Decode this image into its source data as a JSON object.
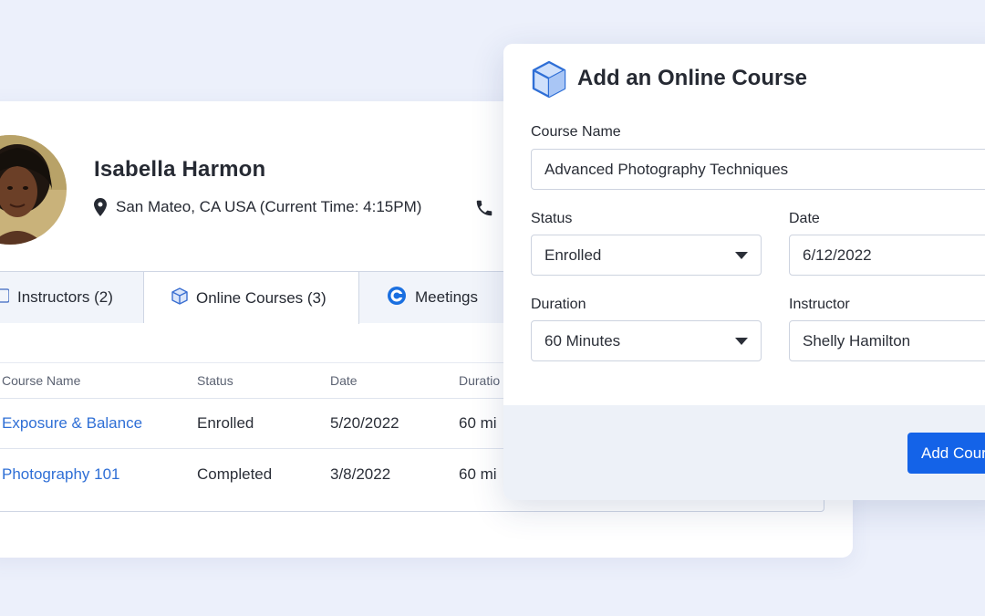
{
  "profile": {
    "name": "Isabella Harmon",
    "location": "San Mateo, CA USA (Current Time: 4:15PM)"
  },
  "tabs": [
    {
      "label": "Instructors (2)",
      "icon": "person-icon",
      "active": false
    },
    {
      "label": "Online Courses (3)",
      "icon": "cube-icon",
      "active": true
    },
    {
      "label": "Meetings",
      "icon": "meetings-logo-icon",
      "active": false
    }
  ],
  "table": {
    "headers": [
      "Course Name",
      "Status",
      "Date",
      "Duratio"
    ],
    "rows": [
      {
        "course": "Exposure & Balance",
        "status": "Enrolled",
        "date": "5/20/2022",
        "duration": "60 mi"
      },
      {
        "course": "Photography 101",
        "status": "Completed",
        "date": "3/8/2022",
        "duration": "60 mi"
      }
    ]
  },
  "modal": {
    "title": "Add an Online Course",
    "course_name_label": "Course Name",
    "course_name_value": "Advanced Photography Techniques",
    "status_label": "Status",
    "status_value": "Enrolled",
    "date_label": "Date",
    "date_value": "6/12/2022",
    "duration_label": "Duration",
    "duration_value": "60 Minutes",
    "instructor_label": "Instructor",
    "instructor_value": "Shelly Hamilton",
    "submit_label": "Add Course"
  },
  "colors": {
    "accent": "#1463e8",
    "link": "#2f6fd6",
    "page_bg": "#ecf0fb"
  }
}
